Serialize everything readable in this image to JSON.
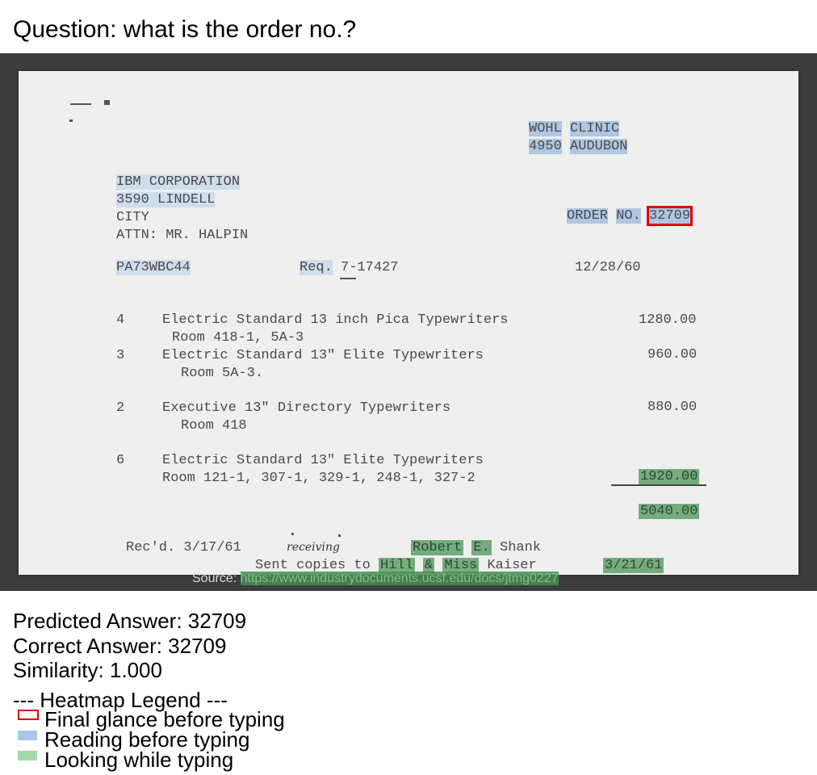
{
  "question": "Question: what is the order no.?",
  "document": {
    "clinic_line1": [
      "WOHL",
      "CLINIC"
    ],
    "clinic_line2": [
      "4950",
      "AUDUBON"
    ],
    "vendor": [
      "IBM CORPORATION",
      "3590 LINDELL",
      "CITY",
      "ATTN: MR. HALPIN"
    ],
    "order_label": [
      "ORDER",
      "NO."
    ],
    "order_number": "32709",
    "po_code": "PA73WBC44",
    "req_label": "Req.",
    "req_number": "7-17427",
    "date": "12/28/60",
    "items": [
      {
        "qty": "4",
        "desc": "Electric Standard 13 inch Pica Typewriters",
        "room": "Room 418-1, 5A-3",
        "amount": "1280.00"
      },
      {
        "qty": "3",
        "desc": "Electric Standard 13\" Elite Typewriters",
        "room": "Room 5A-3.",
        "amount": "960.00"
      },
      {
        "qty": "2",
        "desc": "Executive 13\" Directory Typewriters",
        "room": "Room 418",
        "amount": "880.00"
      },
      {
        "qty": "6",
        "desc": "Electric Standard 13\" Elite Typewriters",
        "room": "Room 121-1, 307-1, 329-1, 248-1, 327-2",
        "amount": "1920.00"
      }
    ],
    "total": "5040.00",
    "recd": "Rec'd. 3/17/61",
    "receiving_note": "receiving",
    "signer": [
      "Robert",
      "E.",
      "Shank"
    ],
    "sent_prefix": "Sent copies to",
    "sent_names": [
      "Hill",
      "&",
      "Miss",
      "Kaiser"
    ],
    "sent_date": "3/21/61"
  },
  "source": {
    "label": "Source:",
    "url": "https://www.industrydocuments.ucsf.edu/docs/jtmg0227"
  },
  "results": {
    "predicted": "Predicted Answer: 32709",
    "correct": "Correct Answer: 32709",
    "similarity": "Similarity: 1.000"
  },
  "legend": {
    "title": "--- Heatmap Legend ---",
    "items": [
      "Final glance before typing",
      "Reading before typing",
      "Looking while typing"
    ],
    "colors": {
      "final": "#e00000",
      "reading": "#a9c6ea",
      "typing": "#a3d9a6"
    }
  }
}
